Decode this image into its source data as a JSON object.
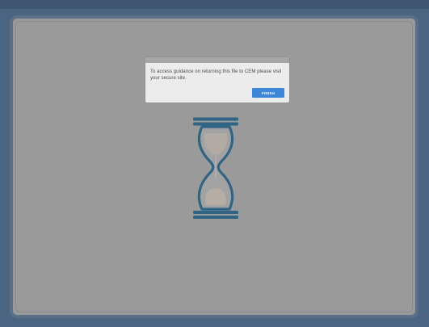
{
  "dialog": {
    "message": "To access guidance on returning this file to CEM please visit your secure site.",
    "finish_label": "FINISH"
  },
  "loading_indicator": {
    "icon": "hourglass-icon"
  },
  "colors": {
    "outer_background": "#4b6482",
    "overlay": "#9a9a9a",
    "dialog_background": "#ececec",
    "accent_button": "#3d87d9",
    "hourglass": "#2f6485"
  }
}
